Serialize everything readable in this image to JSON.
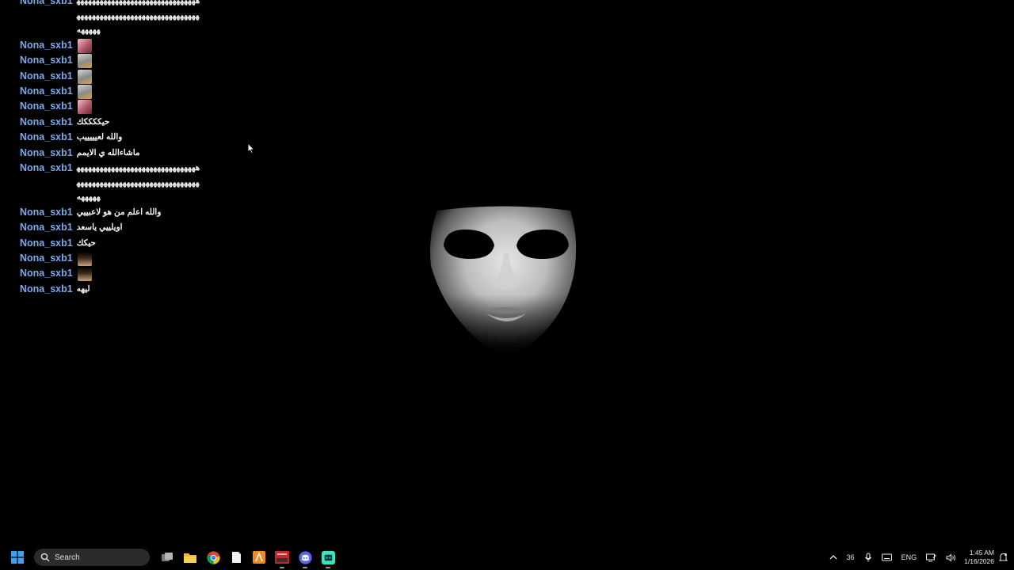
{
  "chat": {
    "messages": [
      {
        "user": "Nona_sxb1",
        "text": "هههههههههههههههههههههههههههههههههههههههههههههههههههههههههههههههههههههه"
      },
      {
        "user": "Nona_sxb1",
        "emote": "pink-face-emote"
      },
      {
        "user": "Nona_sxb1",
        "emote": "gray-face-emote"
      },
      {
        "user": "Nona_sxb1",
        "emote": "gray-face-emote"
      },
      {
        "user": "Nona_sxb1",
        "emote": "gray-face-emote"
      },
      {
        "user": "Nona_sxb1",
        "emote": "pink-face-emote"
      },
      {
        "user": "Nona_sxb1",
        "text": "حيككككك"
      },
      {
        "user": "Nona_sxb1",
        "text": "والله لعيييييب"
      },
      {
        "user": "Nona_sxb1",
        "text": "ماشاءالله ي الايمم"
      },
      {
        "user": "Nona_sxb1",
        "text": "هههههههههههههههههههههههههههههههههههههههههههههههههههههههههههههههههههههه"
      },
      {
        "user": "Nona_sxb1",
        "text": "والله اعلم من هو لاعبييي"
      },
      {
        "user": "Nona_sxb1",
        "text": "اويلييي ياسعد"
      },
      {
        "user": "Nona_sxb1",
        "text": "حيكك"
      },
      {
        "user": "Nona_sxb1",
        "emote": "castle-emote"
      },
      {
        "user": "Nona_sxb1",
        "emote": "castle-emote"
      },
      {
        "user": "Nona_sxb1",
        "text": "ليهه"
      }
    ]
  },
  "taskbar": {
    "search_label": "Search",
    "pinned": [
      "task-view-icon",
      "file-explorer-icon",
      "chrome-icon",
      "notepad-icon",
      "orange-app-icon",
      "red-app-icon",
      "discord-icon",
      "green-app-icon"
    ],
    "tray": {
      "temperature": "36",
      "language": "ENG",
      "time": "1:45 AM",
      "date": "1/16/2026"
    }
  },
  "colors": {
    "background": "#000000",
    "username": "#7fa9e6",
    "message_text": "#f4f4f4",
    "windows_blue": "#3aa0f0",
    "green_app": "#3fe0c0",
    "discord": "#5865f2"
  }
}
